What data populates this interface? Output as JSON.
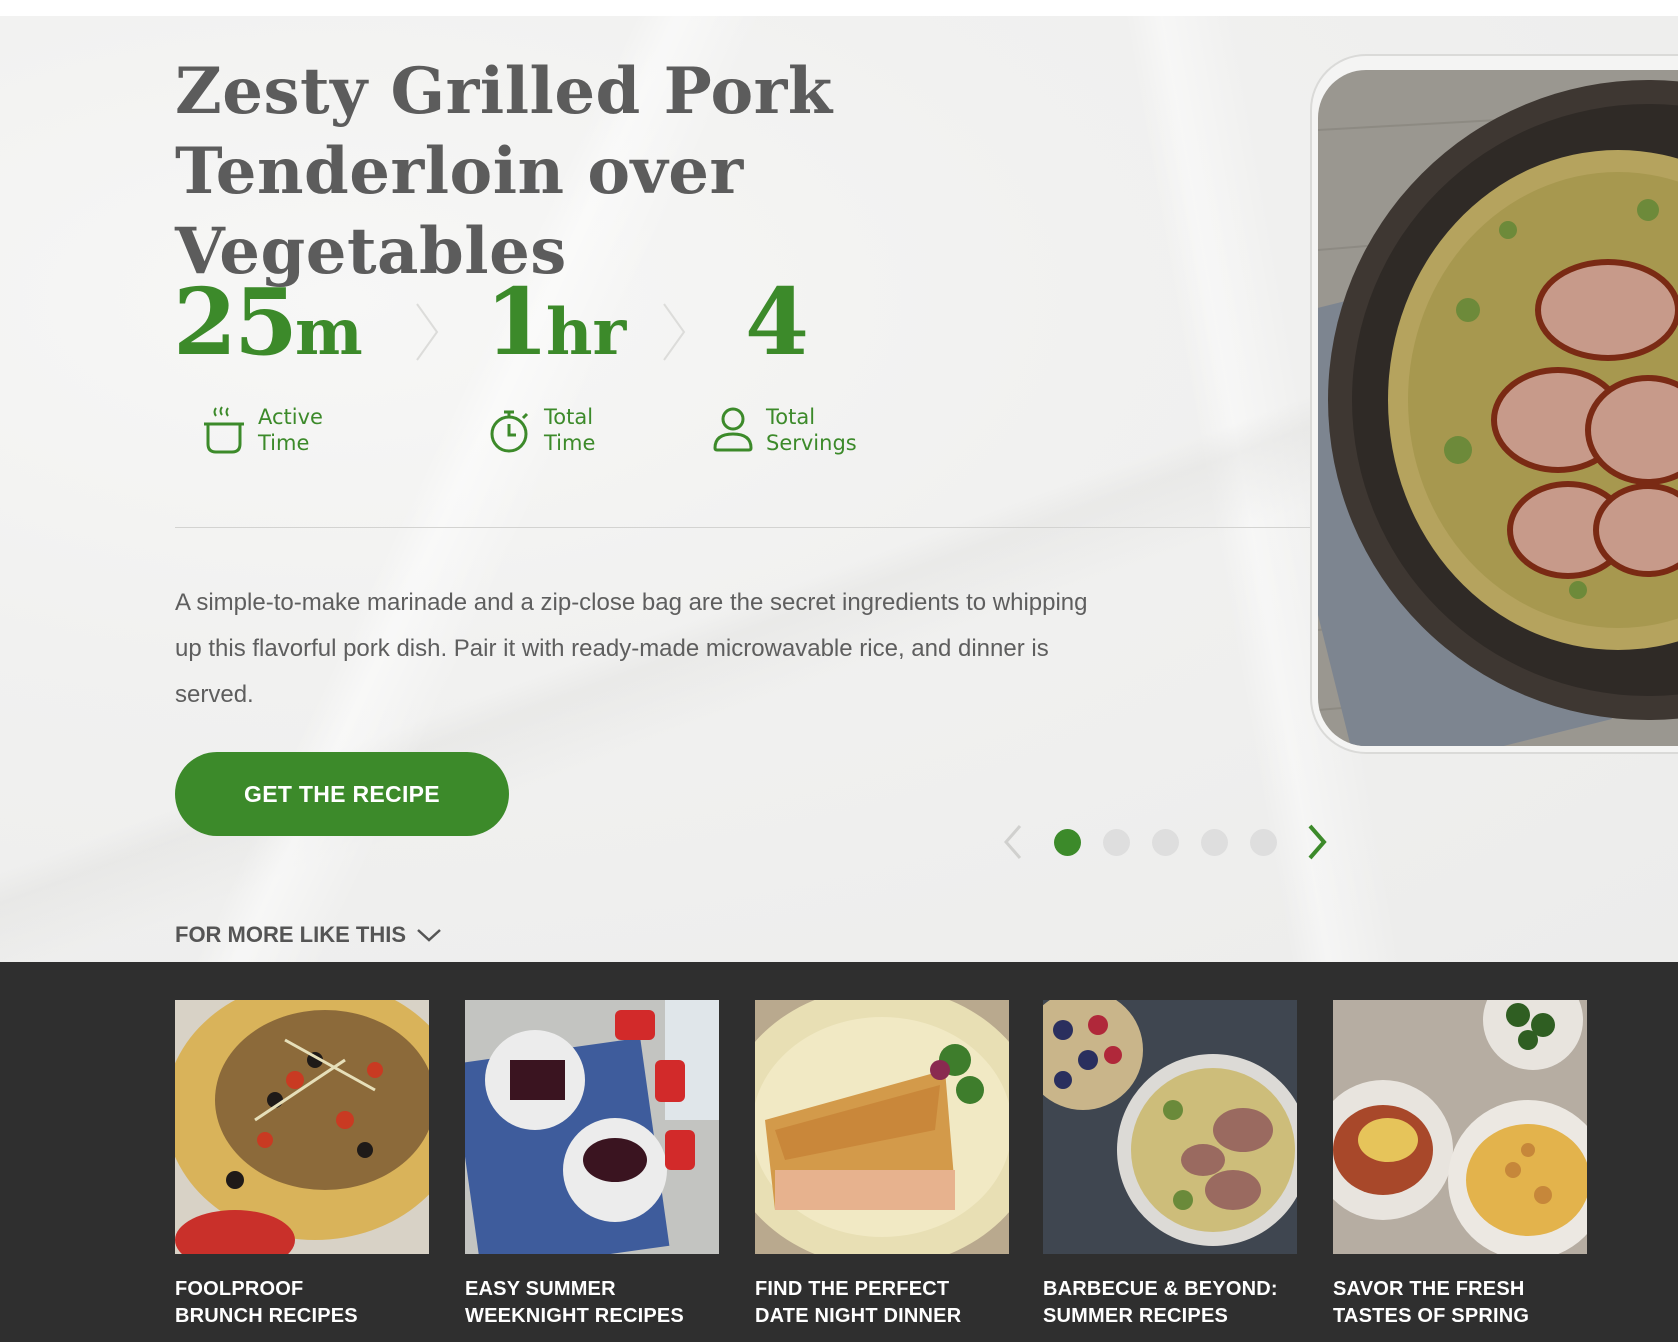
{
  "recipe": {
    "title": "Zesty Grilled Pork Tenderloin over Vegetables",
    "active_time": {
      "value": "25",
      "unit": "m",
      "label_line1": "Active",
      "label_line2": "Time",
      "icon": "pot-icon"
    },
    "total_time": {
      "value": "1",
      "unit": "hr",
      "label_line1": "Total",
      "label_line2": "Time",
      "icon": "stopwatch-icon"
    },
    "servings": {
      "value": "4",
      "label_line1": "Total",
      "label_line2": "Servings",
      "icon": "person-icon"
    },
    "description": "A simple-to-make marinade and a zip-close bag are the secret ingredients to whipping up this flavorful pork dish. Pair it with ready-made microwavable rice, and dinner is served.",
    "cta_label": "GET THE RECIPE"
  },
  "carousel": {
    "total": 5,
    "active": 1,
    "prev_icon": "chevron-left-icon",
    "next_icon": "chevron-right-icon"
  },
  "more": {
    "label": "FOR MORE LIKE THIS",
    "icon": "chevron-down-icon"
  },
  "collections": [
    {
      "title": "FOOLPROOF\nBRUNCH RECIPES"
    },
    {
      "title": "EASY SUMMER\nWEEKNIGHT RECIPES"
    },
    {
      "title": "FIND THE PERFECT\nDATE NIGHT DINNER"
    },
    {
      "title": "BARBECUE & BEYOND:\nSUMMER RECIPES"
    },
    {
      "title": "SAVOR THE FRESH\nTASTES OF SPRING"
    }
  ],
  "colors": {
    "accent_green": "#3c8a2a",
    "dark_band": "#2f2f2f",
    "title_gray": "#5c5c5c"
  }
}
